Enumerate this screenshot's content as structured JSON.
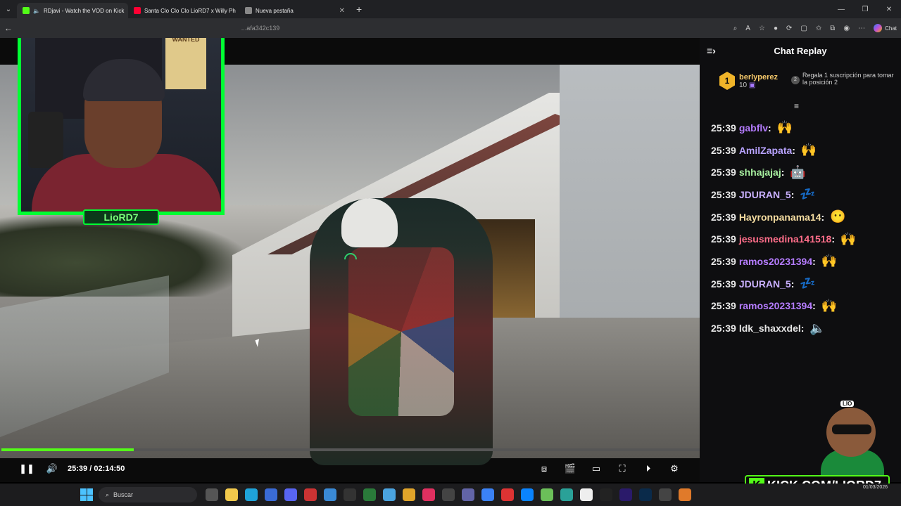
{
  "browser": {
    "tabs": [
      {
        "label": "RDjavi - Watch the VOD on Kick",
        "icon_color": "#53fc18"
      },
      {
        "label": "Santa Clo Clo Clo LioRD7 x Willy Ph",
        "icon_color": "#ff0033"
      },
      {
        "label": "Nueva pestaña",
        "icon_color": "#888888"
      }
    ],
    "url": "...afa342c139",
    "copilot_label": "Chat"
  },
  "player": {
    "current_time": "25:39",
    "separator": "/",
    "duration": "02:14:50",
    "progress_fraction": 0.19,
    "webcam_name": "LioRD7",
    "poster_text": "WANTED"
  },
  "chat": {
    "title": "Chat Replay",
    "top_gifter": {
      "rank": "1",
      "name": "berlyperez",
      "count": "10"
    },
    "gift_cta": {
      "rank": "2",
      "text": "Regala 1 suscripción para tomar la posición 2"
    },
    "messages": [
      {
        "time": "25:39",
        "user": "gabflv",
        "color": "#b57cff",
        "emote": "clap"
      },
      {
        "time": "25:39",
        "user": "AmilZapata",
        "color": "#b8a3ff",
        "emote": "clap"
      },
      {
        "time": "25:39",
        "user": "shhajajaj",
        "color": "#a8f0a0",
        "emote": "red-bot"
      },
      {
        "time": "25:39",
        "user": "JDURAN_5",
        "color": "#c9b0ff",
        "emote": "sleep"
      },
      {
        "time": "25:39",
        "user": "Hayronpanama14",
        "color": "#f4dca0",
        "emote": "yellow-face"
      },
      {
        "time": "25:39",
        "user": "jesusmedina141518",
        "color": "#ff6e8a",
        "emote": "clap"
      },
      {
        "time": "25:39",
        "user": "ramos20231394",
        "color": "#b57cff",
        "emote": "clap"
      },
      {
        "time": "25:39",
        "user": "JDURAN_5",
        "color": "#c9b0ff",
        "emote": "sleep"
      },
      {
        "time": "25:39",
        "user": "ramos20231394",
        "color": "#b57cff",
        "emote": "clap"
      },
      {
        "time": "25:39",
        "user": "ldk_shaxxdel",
        "color": "#e6e6e6",
        "emote": "speaker"
      }
    ]
  },
  "overlay": {
    "kick_url": "KICK.COM/LIORD7",
    "mascot_label": "LIO"
  },
  "taskbar": {
    "search_placeholder": "Buscar",
    "date": "01/03/2026"
  }
}
